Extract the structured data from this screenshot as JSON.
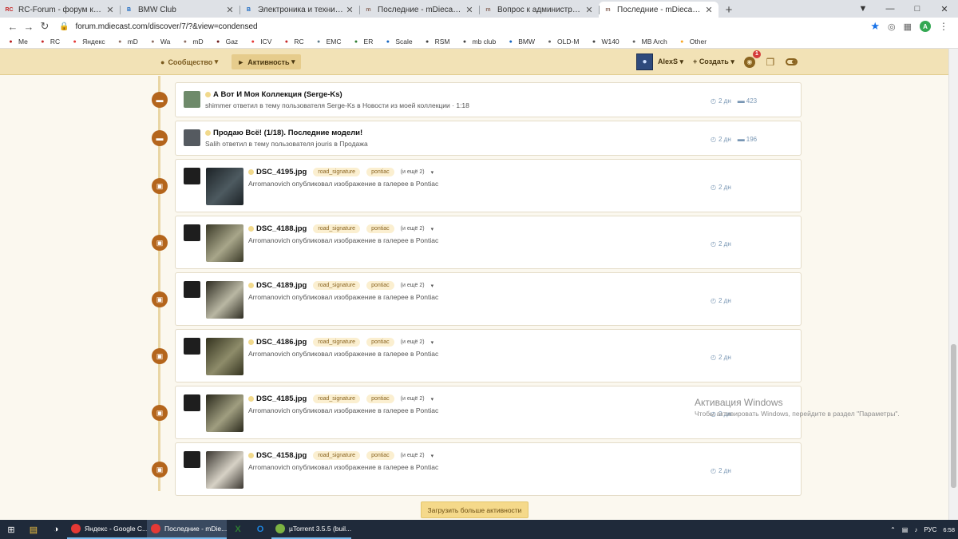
{
  "browser": {
    "tabs": [
      {
        "title": "RC-Forum - форум коллекционе",
        "fav": "RC",
        "fav_color": "#c62828",
        "active": false
      },
      {
        "title": "BMW Club",
        "fav": "B",
        "fav_color": "#1565c0",
        "active": false
      },
      {
        "title": "Электроника и техника | BMW Cl",
        "fav": "B",
        "fav_color": "#1565c0",
        "active": false
      },
      {
        "title": "Последние - mDiecast Forums",
        "fav": "m",
        "fav_color": "#8d6e63",
        "active": false
      },
      {
        "title": "Вопрос к администрации фору",
        "fav": "m",
        "fav_color": "#8d6e63",
        "active": false
      },
      {
        "title": "Последние - mDiecast Forums",
        "fav": "m",
        "fav_color": "#8d6e63",
        "active": true
      }
    ],
    "url": "forum.mdiecast.com/discover/7/?&view=condensed",
    "bookmarks": [
      {
        "label": "Me",
        "color": "#b71c1c"
      },
      {
        "label": "RC",
        "color": "#c62828"
      },
      {
        "label": "Яндекс",
        "color": "#e53935"
      },
      {
        "label": "mD",
        "color": "#8d6e63"
      },
      {
        "label": "Wa",
        "color": "#8d6e63"
      },
      {
        "label": "mD",
        "color": "#8d6e63"
      },
      {
        "label": "Gaz",
        "color": "#6d1b1b"
      },
      {
        "label": "ICV",
        "color": "#e53935"
      },
      {
        "label": "RC",
        "color": "#c62828"
      },
      {
        "label": "EMC",
        "color": "#607d8b"
      },
      {
        "label": "ER",
        "color": "#2e7d32"
      },
      {
        "label": "Scale",
        "color": "#1565c0"
      },
      {
        "label": "RSM",
        "color": "#424242"
      },
      {
        "label": "mb club",
        "color": "#424242"
      },
      {
        "label": "BMW",
        "color": "#1565c0"
      },
      {
        "label": "OLD-M",
        "color": "#616161"
      },
      {
        "label": "W140",
        "color": "#424242"
      },
      {
        "label": "MB Arch",
        "color": "#616161"
      },
      {
        "label": "Other",
        "color": "#f9a825"
      }
    ]
  },
  "forum_nav": {
    "community": "Сообщество",
    "activity": "Активность",
    "user": "AlexS",
    "create": "Создать",
    "notif_count": "1"
  },
  "feed": [
    {
      "type": "topic",
      "title": "А Вот И Моя Коллекция (Serge-Ks)",
      "desc": "shimmer ответил в тему пользователя Serge-Ks в Новости из моей коллекции · 1:18",
      "time": "2 дн",
      "comments": "423",
      "avatar_color": "#6e8a6a"
    },
    {
      "type": "topic",
      "title": "Продаю Всё! (1/18). Последние модели!",
      "desc": "Salih ответил в тему пользователя jouris в Продажа",
      "time": "2 дн",
      "comments": "196",
      "avatar_color": "#555a60"
    },
    {
      "type": "image",
      "title": "DSC_4195.jpg",
      "tag1": "road_signature",
      "tag2": "pontiac",
      "more": "(и ещё 2)",
      "desc": "Arromanovich опубликовал изображение в галерее в Pontiac",
      "time": "2 дн",
      "thumb": "#1c2226",
      "thumb2": "#4d5a60"
    },
    {
      "type": "image",
      "title": "DSC_4188.jpg",
      "tag1": "road_signature",
      "tag2": "pontiac",
      "more": "(и ещё 2)",
      "desc": "Arromanovich опубликовал изображение в галерее в Pontiac",
      "time": "2 дн",
      "thumb": "#3b3a28",
      "thumb2": "#a8a68a"
    },
    {
      "type": "image",
      "title": "DSC_4189.jpg",
      "tag1": "road_signature",
      "tag2": "pontiac",
      "more": "(и ещё 2)",
      "desc": "Arromanovich опубликовал изображение в галерее в Pontiac",
      "time": "2 дн",
      "thumb": "#2e2c22",
      "thumb2": "#b9b7a3"
    },
    {
      "type": "image",
      "title": "DSC_4186.jpg",
      "tag1": "road_signature",
      "tag2": "pontiac",
      "more": "(и ещё 2)",
      "desc": "Arromanovich опубликовал изображение в галерее в Pontiac",
      "time": "2 дн",
      "thumb": "#34331f",
      "thumb2": "#8e8c6a"
    },
    {
      "type": "image",
      "title": "DSC_4185.jpg",
      "tag1": "road_signature",
      "tag2": "pontiac",
      "more": "(и ещё 2)",
      "desc": "Arromanovich опубликовал изображение в галерее в Pontiac",
      "time": "2 дн",
      "thumb": "#2a291c",
      "thumb2": "#a09e80"
    },
    {
      "type": "image",
      "title": "DSC_4158.jpg",
      "tag1": "road_signature",
      "tag2": "pontiac",
      "more": "(и ещё 2)",
      "desc": "Arromanovich опубликовал изображение в галерее в Pontiac",
      "time": "2 дн",
      "thumb": "#3a3630",
      "thumb2": "#d7d2c6"
    }
  ],
  "load_more": "Загрузить больше активности",
  "watermark": {
    "line1": "Активация Windows",
    "line2": "Чтобы активировать Windows, перейдите в раздел \"Параметры\"."
  },
  "taskbar": {
    "apps": [
      {
        "label": "Яндекс - Google C...",
        "color": "#e53935",
        "active": false
      },
      {
        "label": "Последние - mDie...",
        "color": "#e53935",
        "active": true
      },
      {
        "label": "µTorrent 3.5.5 (buil...",
        "color": "#7cb342",
        "active": false
      }
    ],
    "lang": "РУС",
    "time": "6:58"
  },
  "colors": {
    "accent": "#b4651c",
    "nav_bg": "#f2e2b6",
    "page_bg": "#fbf8ef"
  }
}
